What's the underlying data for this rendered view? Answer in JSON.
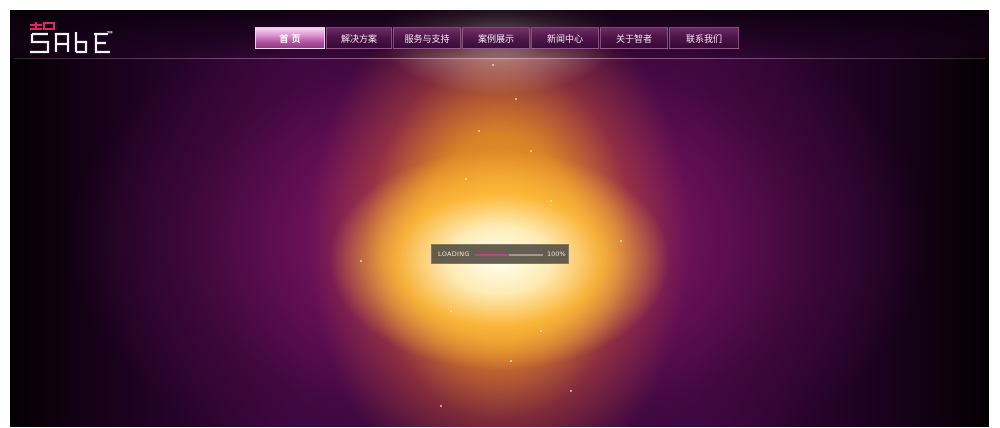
{
  "logo": {
    "mark": "SABE",
    "tm": "™"
  },
  "nav": {
    "items": [
      {
        "label": "首 页",
        "active": true
      },
      {
        "label": "解决方案",
        "active": false
      },
      {
        "label": "服务与支持",
        "active": false
      },
      {
        "label": "案例展示",
        "active": false
      },
      {
        "label": "新闻中心",
        "active": false
      },
      {
        "label": "关于智者",
        "active": false
      },
      {
        "label": "联系我们",
        "active": false
      }
    ]
  },
  "loading": {
    "label": "LOADING",
    "percent_text": "100%",
    "progress": 0.5
  },
  "colors": {
    "accent": "#b8468f",
    "nav_active": "#d78ed0",
    "background": "#3c0640",
    "glow": "#faaf23"
  }
}
